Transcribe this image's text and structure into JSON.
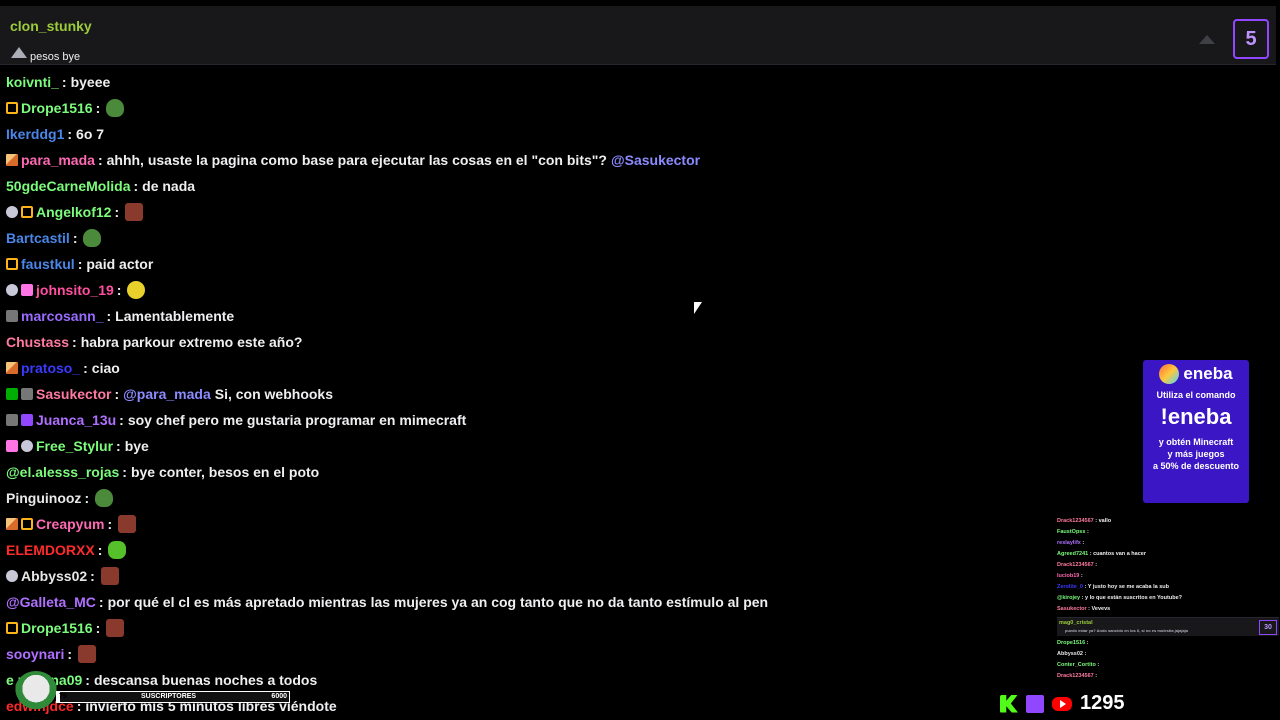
{
  "pinned": {
    "user": "clon_stunky",
    "message": "pesos bye",
    "count": "5"
  },
  "chat": [
    {
      "badges": [],
      "name": "koivnti_",
      "color": "#7cfc7c",
      "text": "byeee",
      "emote": ""
    },
    {
      "badges": [
        "crown"
      ],
      "name": "Drope1516",
      "color": "#7cfc7c",
      "text": "",
      "emote": "frog"
    },
    {
      "badges": [],
      "name": "Ikerddg1",
      "color": "#4a86e8",
      "text": "6o 7",
      "emote": ""
    },
    {
      "badges": [
        "pencil"
      ],
      "name": "para_mada",
      "color": "#ff69b4",
      "text": "ahhh, usaste la pagina como base para ejecutar las cosas en el \"con bits\"?",
      "mention_after": "@Sasukector",
      "emote": ""
    },
    {
      "badges": [],
      "name": "50gdeCarneMolida",
      "color": "#7cfc7c",
      "text": "de nada",
      "emote": ""
    },
    {
      "badges": [
        "white",
        "crown"
      ],
      "name": "Angelkof12",
      "color": "#7cfc7c",
      "text": "",
      "emote": "brown"
    },
    {
      "badges": [],
      "name": "Bartcastil",
      "color": "#4a86e8",
      "text": "",
      "emote": "frog"
    },
    {
      "badges": [
        "crown"
      ],
      "name": "faustkul",
      "color": "#4a86e8",
      "text": "paid actor",
      "emote": ""
    },
    {
      "badges": [
        "white",
        "heart"
      ],
      "name": "johnsito_19",
      "color": "#ff4fa0",
      "text": "",
      "emote": "yellow"
    },
    {
      "badges": [
        "gray"
      ],
      "name": "marcosann_",
      "color": "#9a6bff",
      "text": "Lamentablemente",
      "emote": ""
    },
    {
      "badges": [],
      "name": "Chustass",
      "color": "#ff7aa0",
      "text": "habra parkour extremo este año?",
      "emote": ""
    },
    {
      "badges": [
        "pencil"
      ],
      "name": "pratoso_",
      "color": "#3a3aff",
      "text": "ciao",
      "emote": ""
    },
    {
      "badges": [
        "check",
        "gray"
      ],
      "name": "Sasukector",
      "color": "#ff7aa0",
      "mention": "@para_mada",
      "text": "Si, con webhooks",
      "emote": ""
    },
    {
      "badges": [
        "gray",
        "purple"
      ],
      "name": "Juanca_13u",
      "color": "#b070ff",
      "text": "soy chef pero me gustaria programar en mimecraft",
      "emote": ""
    },
    {
      "badges": [
        "heart",
        "white"
      ],
      "name": "Free_Stylur",
      "color": "#7cfc7c",
      "text": "bye",
      "emote": ""
    },
    {
      "badges": [],
      "name": "@el.alesss_rojas",
      "color": "#7cfc7c",
      "text": "bye conter, besos en el poto",
      "emote": ""
    },
    {
      "badges": [],
      "name": "Pinguinooz",
      "color": "#e8e8e8",
      "text": "",
      "emote": "frog"
    },
    {
      "badges": [
        "pencil",
        "crown"
      ],
      "name": "Creapyum",
      "color": "#ff69b4",
      "text": "",
      "emote": "brown"
    },
    {
      "badges": [],
      "name": "ELEMDORXX",
      "color": "#ff2a2a",
      "text": "",
      "emote": "green"
    },
    {
      "badges": [
        "white"
      ],
      "name": "Abbyss02",
      "color": "#e8e8e8",
      "text": "",
      "emote": "brown"
    },
    {
      "badges": [],
      "name": "@Galleta_MC",
      "color": "#b070ff",
      "text": "por qué el cl es más apretado mientras las mujeres ya an cog tanto que no da tanto estímulo al pen",
      "emote": ""
    },
    {
      "badges": [
        "crown"
      ],
      "name": "Drope1516",
      "color": "#7cfc7c",
      "text": "",
      "emote": "brown"
    },
    {
      "badges": [],
      "name": "sooynari",
      "color": "#b070ff",
      "text": "",
      "emote": "brown"
    },
    {
      "badges": [],
      "name": "e  medina09",
      "color": "#7cfc7c",
      "text": "descansa buenas noches a todos",
      "emote": ""
    },
    {
      "badges": [],
      "name": "edwinjdce",
      "color": "#ff2a2a",
      "text": "invierto mis 5 minutos libres viéndote",
      "emote": ""
    }
  ],
  "ad": {
    "brand": "eneba",
    "line1": "Utiliza el comando",
    "command": "!eneba",
    "line2": "y obtén Minecraft",
    "line3": "y más juegos",
    "line4": "a 50% de descuento"
  },
  "mini_chat": [
    {
      "name": "Drack1234567",
      "color": "#ff7aa0",
      "text": "vallo"
    },
    {
      "name": "FaustOpss",
      "color": "#7cfc7c",
      "text": ""
    },
    {
      "name": "reslaylifx",
      "color": "#b070ff",
      "text": ""
    },
    {
      "name": "Agreed7241",
      "color": "#7cfc7c",
      "text": "cuantos van a hacer"
    },
    {
      "name": "Drack1234567",
      "color": "#ff7aa0",
      "text": ""
    },
    {
      "name": "luciob19",
      "color": "#ff69b4",
      "text": ""
    },
    {
      "name": "Zerolite_0",
      "color": "#3a3aff",
      "text": "Y justo hoy se me acaba la sub"
    },
    {
      "name": "@kirojey",
      "color": "#7cfc7c",
      "text": "y lo que están suscritos en Youtube?"
    },
    {
      "name": "Sasukector",
      "color": "#ff7aa0",
      "text": "Vevevs"
    }
  ],
  "mini_pinned": {
    "user": "mag0_cristal",
    "message": "puedo estar ya? Ando sancido en los 6, si no es molestia jajajaja",
    "count": "30"
  },
  "mini_chat2": [
    {
      "name": "Drope1516",
      "color": "#7cfc7c",
      "text": ""
    },
    {
      "name": "Abbyss02",
      "color": "#e8e8e8",
      "text": ""
    },
    {
      "name": "Conter_Cortito",
      "color": "#7cfc7c",
      "text": ""
    },
    {
      "name": "Drack1234567",
      "color": "#ff7aa0",
      "text": ""
    }
  ],
  "viewers": "1295",
  "subs_goal": {
    "label": "SUSCRIPTORES",
    "current": "79",
    "goal": "6000",
    "progress": 0.013
  }
}
